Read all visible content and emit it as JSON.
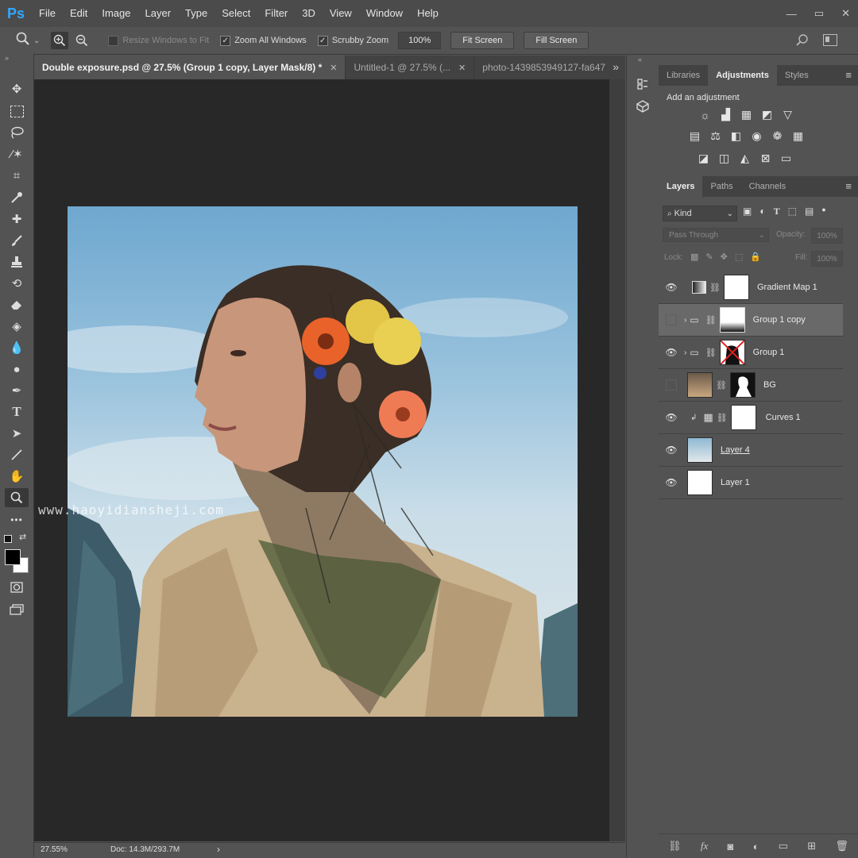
{
  "app": {
    "logo": "Ps"
  },
  "menubar": {
    "items": [
      "File",
      "Edit",
      "Image",
      "Layer",
      "Type",
      "Select",
      "Filter",
      "3D",
      "View",
      "Window",
      "Help"
    ],
    "window_controls": {
      "minimize": "—",
      "restore": "▭",
      "close": "✕"
    }
  },
  "options_bar": {
    "zoom_tool_icon": "zoom-icon",
    "resize_windows_to_fit": {
      "label": "Resize Windows to Fit",
      "checked": false,
      "enabled": false
    },
    "zoom_all_windows": {
      "label": "Zoom All Windows",
      "checked": true
    },
    "scrubby_zoom": {
      "label": "Scrubby Zoom",
      "checked": true
    },
    "zoom_value": "100%",
    "fit_screen": "Fit Screen",
    "fill_screen": "Fill Screen"
  },
  "tabs": [
    {
      "title": "Double exposure.psd @ 27.5% (Group 1 copy, Layer Mask/8) *",
      "active": true
    },
    {
      "title": "Untitled-1 @ 27.5% (...",
      "active": false
    },
    {
      "title": "photo-1439853949127-fa647",
      "active": false
    }
  ],
  "tab_overflow": "»",
  "canvas": {
    "watermark": "www.haoyidiansheji.com"
  },
  "status_bar": {
    "zoom": "27.55%",
    "doc": "Doc: 14.3M/293.7M",
    "arrow": "›"
  },
  "panels": {
    "top_tabs": [
      "Libraries",
      "Adjustments",
      "Styles"
    ],
    "adjustments": {
      "heading": "Add an adjustment"
    },
    "layer_tabs": [
      "Layers",
      "Paths",
      "Channels"
    ],
    "kind_filter": "Kind",
    "blend_mode": "Pass Through",
    "opacity_label": "Opacity:",
    "opacity_value": "100%",
    "lock_label": "Lock:",
    "fill_label": "Fill:",
    "fill_value": "100%",
    "layers": [
      {
        "name": "Gradient Map 1",
        "visible": true,
        "selected": false
      },
      {
        "name": "Group 1 copy",
        "visible": false,
        "selected": true
      },
      {
        "name": "Group 1",
        "visible": true,
        "selected": false
      },
      {
        "name": "BG",
        "visible": false,
        "selected": false
      },
      {
        "name": "Curves 1",
        "visible": true,
        "selected": false
      },
      {
        "name": "Layer 4",
        "visible": true,
        "selected": false
      },
      {
        "name": "Layer 1",
        "visible": true,
        "selected": false
      }
    ]
  }
}
